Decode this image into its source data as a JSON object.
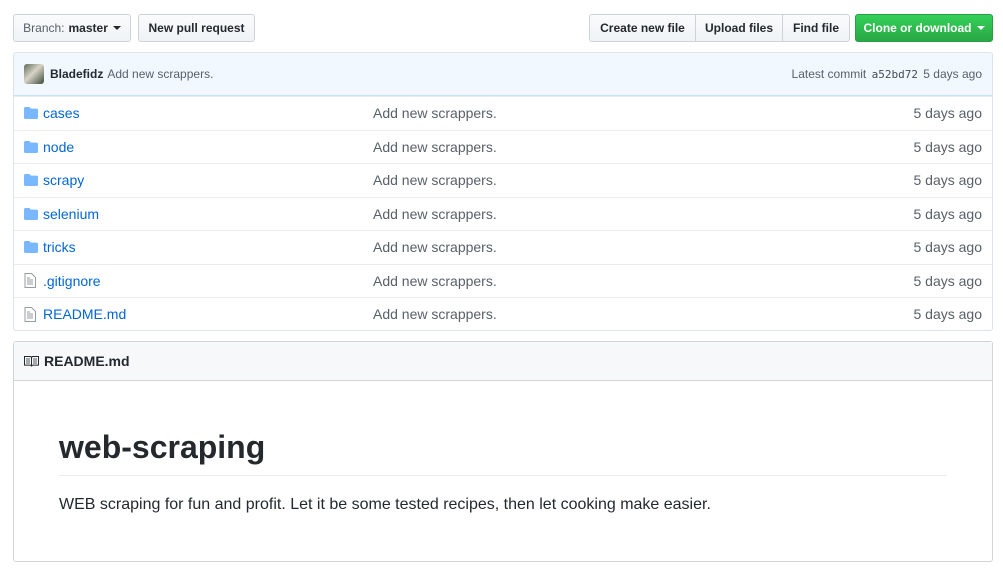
{
  "toolbar": {
    "branch_prefix": "Branch:",
    "branch_name": "master",
    "new_pr": "New pull request",
    "create_file": "Create new file",
    "upload_files": "Upload files",
    "find_file": "Find file",
    "clone": "Clone or download"
  },
  "commit": {
    "author": "Bladefidz",
    "message": "Add new scrappers.",
    "latest_label": "Latest commit",
    "sha": "a52bd72",
    "age": "5 days ago"
  },
  "files": [
    {
      "name": "cases",
      "type": "folder",
      "message": "Add new scrappers.",
      "age": "5 days ago"
    },
    {
      "name": "node",
      "type": "folder",
      "message": "Add new scrappers.",
      "age": "5 days ago"
    },
    {
      "name": "scrapy",
      "type": "folder",
      "message": "Add new scrappers.",
      "age": "5 days ago"
    },
    {
      "name": "selenium",
      "type": "folder",
      "message": "Add new scrappers.",
      "age": "5 days ago"
    },
    {
      "name": "tricks",
      "type": "folder",
      "message": "Add new scrappers.",
      "age": "5 days ago"
    },
    {
      "name": ".gitignore",
      "type": "file",
      "message": "Add new scrappers.",
      "age": "5 days ago"
    },
    {
      "name": "README.md",
      "type": "file",
      "message": "Add new scrappers.",
      "age": "5 days ago"
    }
  ],
  "readme": {
    "header": "README.md",
    "title": "web-scraping",
    "description": "WEB scraping for fun and profit. Let it be some tested recipes, then let cooking make easier."
  },
  "colors": {
    "link": "#0366d6",
    "green": "#28a745",
    "folder": "#79b8ff"
  },
  "icons": {
    "folder": "folder-icon",
    "file": "file-icon",
    "book": "book-icon",
    "caret": "caret-down-icon"
  }
}
